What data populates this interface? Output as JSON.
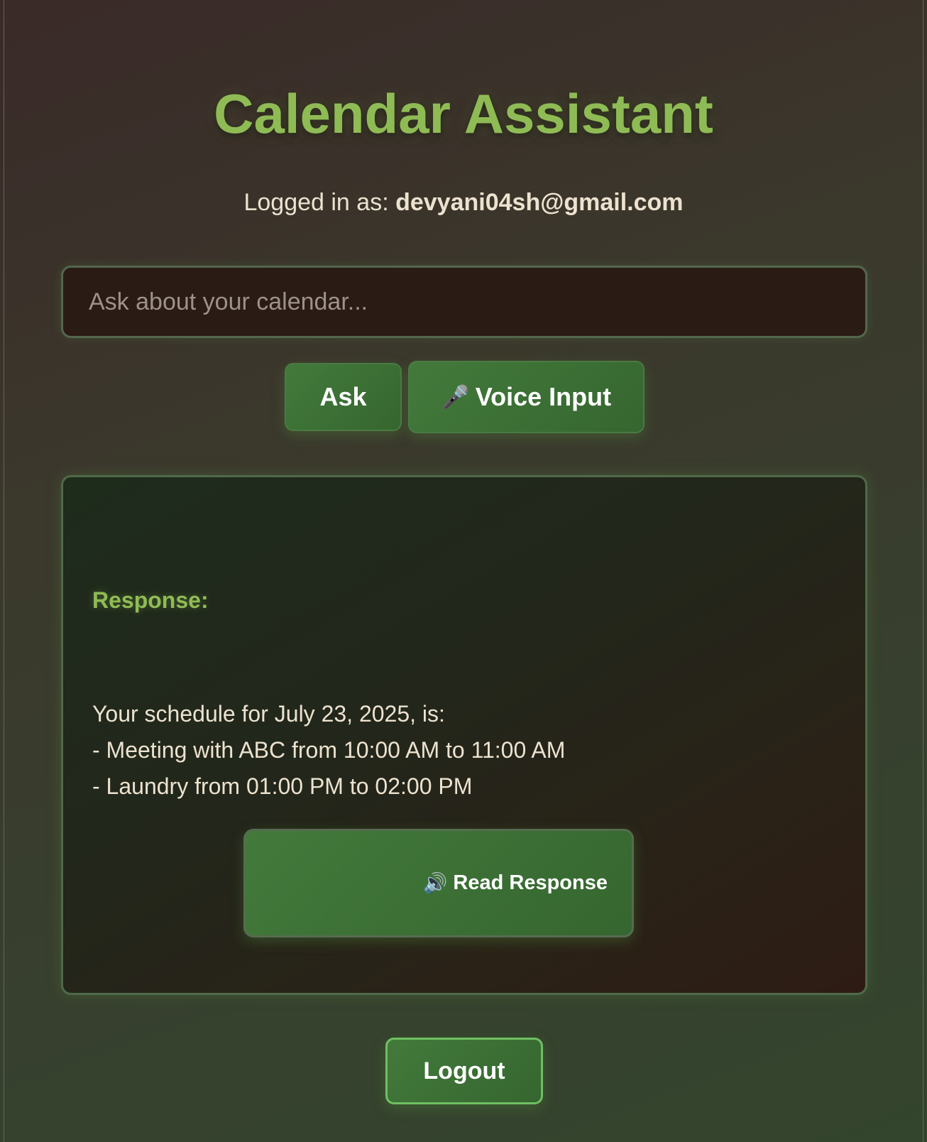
{
  "app": {
    "title": "Calendar Assistant"
  },
  "login": {
    "prefix": "Logged in as: ",
    "email": "devyani04sh@gmail.com"
  },
  "query": {
    "placeholder": "Ask about your calendar...",
    "value": ""
  },
  "actions": {
    "ask_label": "Ask",
    "voice_icon": "microphone-icon",
    "voice_glyph": "🎤",
    "voice_label": "Voice Input"
  },
  "response": {
    "label": "Response:",
    "lines": [
      "Your schedule for July 23, 2025, is:",
      "- Meeting with ABC from 10:00 AM to 11:00 AM",
      "- Laundry from 01:00 PM to 02:00 PM"
    ],
    "read_icon": "speaker-icon",
    "read_glyph": "🔊",
    "read_label": "Read Response"
  },
  "footer": {
    "logout_label": "Logout"
  },
  "colors": {
    "accent": "#8fbb55",
    "button": "#3f7238",
    "input_bg": "#2b1b15"
  }
}
